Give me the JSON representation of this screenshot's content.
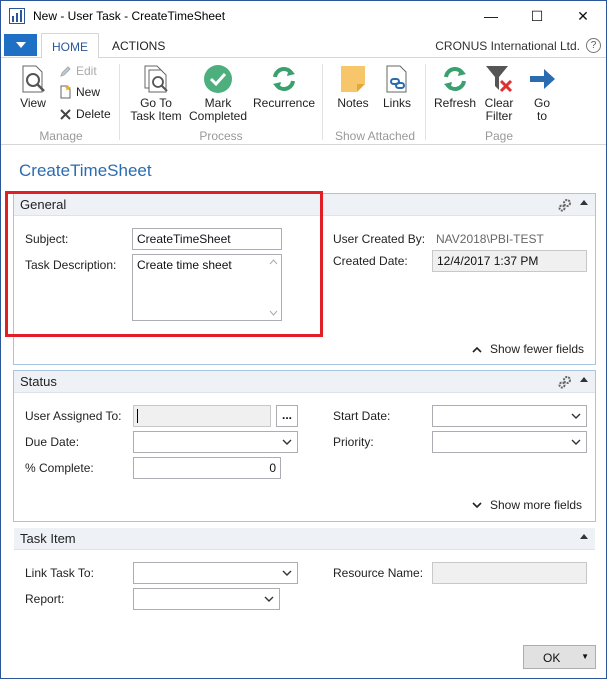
{
  "window": {
    "title": "New - User Task - CreateTimeSheet",
    "minimize": "—",
    "maximize": "☐",
    "close": "✕"
  },
  "tabs": {
    "home": "HOME",
    "actions": "ACTIONS"
  },
  "company": "CRONUS International Ltd.",
  "help": "?",
  "ribbon": {
    "view": "View",
    "edit": "Edit",
    "new": "New",
    "delete": "Delete",
    "manage": "Manage",
    "go_to_task_item": [
      "Go To",
      "Task Item"
    ],
    "mark_completed": [
      "Mark",
      "Completed"
    ],
    "recurrence": "Recurrence",
    "process": "Process",
    "notes": "Notes",
    "links": "Links",
    "show_attached": "Show Attached",
    "refresh": "Refresh",
    "clear_filter": [
      "Clear",
      "Filter"
    ],
    "go_to": [
      "Go",
      "to"
    ],
    "page": "Page"
  },
  "page_title": "CreateTimeSheet",
  "general": {
    "title": "General",
    "subject_label": "Subject:",
    "subject_value": "CreateTimeSheet",
    "task_description_label": "Task Description:",
    "task_description_value": "Create time sheet",
    "user_created_by_label": "User Created By:",
    "user_created_by_value": "NAV2018\\PBI-TEST",
    "created_date_label": "Created Date:",
    "created_date_value": "12/4/2017 1:37 PM",
    "show_fewer": "Show fewer fields"
  },
  "status": {
    "title": "Status",
    "user_assigned_to_label": "User Assigned To:",
    "user_assigned_to_value": "",
    "lookup": "...",
    "start_date_label": "Start Date:",
    "due_date_label": "Due Date:",
    "priority_label": "Priority:",
    "percent_complete_label": "% Complete:",
    "percent_complete_value": "0",
    "show_more": "Show more fields"
  },
  "task_item": {
    "title": "Task Item",
    "link_task_to_label": "Link Task To:",
    "resource_name_label": "Resource Name:",
    "report_label": "Report:"
  },
  "ok": "OK",
  "colors": {
    "accent": "#2b6cb0",
    "highlight": "#e01f26",
    "ribbon_blue": "#1f6fc5"
  }
}
